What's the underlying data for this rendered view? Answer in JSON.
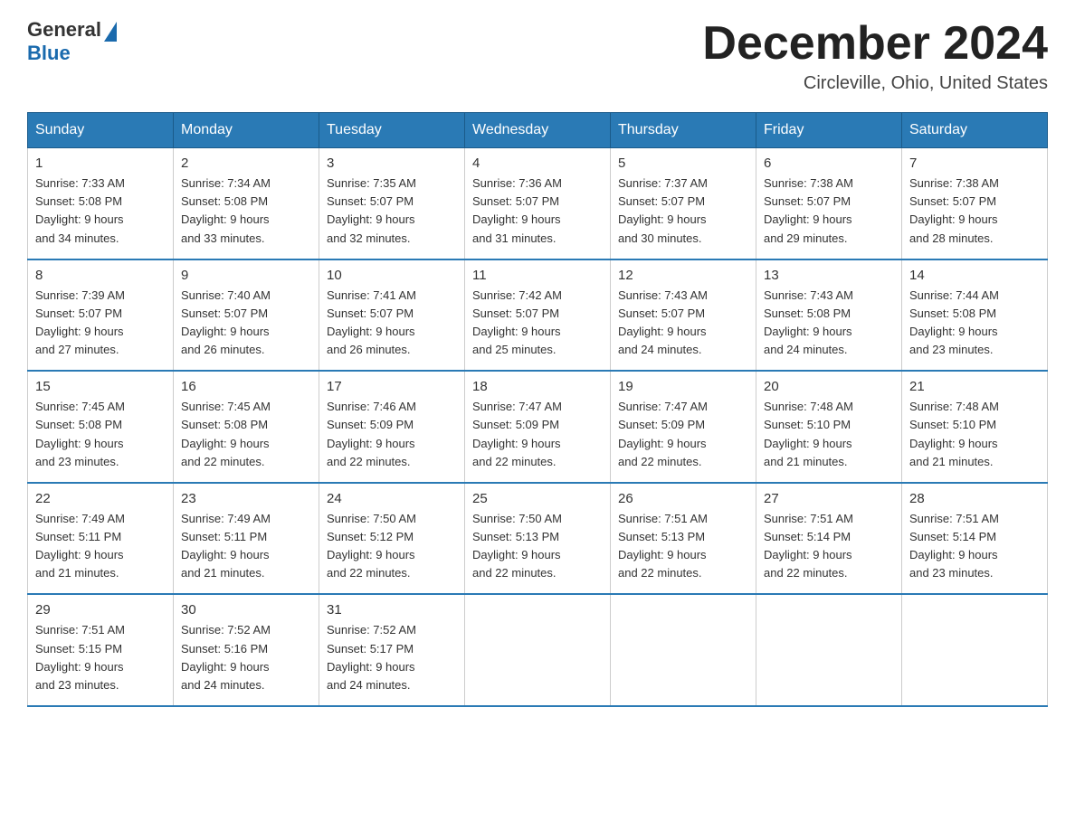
{
  "header": {
    "logo_general": "General",
    "logo_blue": "Blue",
    "month_title": "December 2024",
    "location": "Circleville, Ohio, United States"
  },
  "days_of_week": [
    "Sunday",
    "Monday",
    "Tuesday",
    "Wednesday",
    "Thursday",
    "Friday",
    "Saturday"
  ],
  "weeks": [
    [
      {
        "num": "1",
        "sunrise": "7:33 AM",
        "sunset": "5:08 PM",
        "daylight": "9 hours and 34 minutes."
      },
      {
        "num": "2",
        "sunrise": "7:34 AM",
        "sunset": "5:08 PM",
        "daylight": "9 hours and 33 minutes."
      },
      {
        "num": "3",
        "sunrise": "7:35 AM",
        "sunset": "5:07 PM",
        "daylight": "9 hours and 32 minutes."
      },
      {
        "num": "4",
        "sunrise": "7:36 AM",
        "sunset": "5:07 PM",
        "daylight": "9 hours and 31 minutes."
      },
      {
        "num": "5",
        "sunrise": "7:37 AM",
        "sunset": "5:07 PM",
        "daylight": "9 hours and 30 minutes."
      },
      {
        "num": "6",
        "sunrise": "7:38 AM",
        "sunset": "5:07 PM",
        "daylight": "9 hours and 29 minutes."
      },
      {
        "num": "7",
        "sunrise": "7:38 AM",
        "sunset": "5:07 PM",
        "daylight": "9 hours and 28 minutes."
      }
    ],
    [
      {
        "num": "8",
        "sunrise": "7:39 AM",
        "sunset": "5:07 PM",
        "daylight": "9 hours and 27 minutes."
      },
      {
        "num": "9",
        "sunrise": "7:40 AM",
        "sunset": "5:07 PM",
        "daylight": "9 hours and 26 minutes."
      },
      {
        "num": "10",
        "sunrise": "7:41 AM",
        "sunset": "5:07 PM",
        "daylight": "9 hours and 26 minutes."
      },
      {
        "num": "11",
        "sunrise": "7:42 AM",
        "sunset": "5:07 PM",
        "daylight": "9 hours and 25 minutes."
      },
      {
        "num": "12",
        "sunrise": "7:43 AM",
        "sunset": "5:07 PM",
        "daylight": "9 hours and 24 minutes."
      },
      {
        "num": "13",
        "sunrise": "7:43 AM",
        "sunset": "5:08 PM",
        "daylight": "9 hours and 24 minutes."
      },
      {
        "num": "14",
        "sunrise": "7:44 AM",
        "sunset": "5:08 PM",
        "daylight": "9 hours and 23 minutes."
      }
    ],
    [
      {
        "num": "15",
        "sunrise": "7:45 AM",
        "sunset": "5:08 PM",
        "daylight": "9 hours and 23 minutes."
      },
      {
        "num": "16",
        "sunrise": "7:45 AM",
        "sunset": "5:08 PM",
        "daylight": "9 hours and 22 minutes."
      },
      {
        "num": "17",
        "sunrise": "7:46 AM",
        "sunset": "5:09 PM",
        "daylight": "9 hours and 22 minutes."
      },
      {
        "num": "18",
        "sunrise": "7:47 AM",
        "sunset": "5:09 PM",
        "daylight": "9 hours and 22 minutes."
      },
      {
        "num": "19",
        "sunrise": "7:47 AM",
        "sunset": "5:09 PM",
        "daylight": "9 hours and 22 minutes."
      },
      {
        "num": "20",
        "sunrise": "7:48 AM",
        "sunset": "5:10 PM",
        "daylight": "9 hours and 21 minutes."
      },
      {
        "num": "21",
        "sunrise": "7:48 AM",
        "sunset": "5:10 PM",
        "daylight": "9 hours and 21 minutes."
      }
    ],
    [
      {
        "num": "22",
        "sunrise": "7:49 AM",
        "sunset": "5:11 PM",
        "daylight": "9 hours and 21 minutes."
      },
      {
        "num": "23",
        "sunrise": "7:49 AM",
        "sunset": "5:11 PM",
        "daylight": "9 hours and 21 minutes."
      },
      {
        "num": "24",
        "sunrise": "7:50 AM",
        "sunset": "5:12 PM",
        "daylight": "9 hours and 22 minutes."
      },
      {
        "num": "25",
        "sunrise": "7:50 AM",
        "sunset": "5:13 PM",
        "daylight": "9 hours and 22 minutes."
      },
      {
        "num": "26",
        "sunrise": "7:51 AM",
        "sunset": "5:13 PM",
        "daylight": "9 hours and 22 minutes."
      },
      {
        "num": "27",
        "sunrise": "7:51 AM",
        "sunset": "5:14 PM",
        "daylight": "9 hours and 22 minutes."
      },
      {
        "num": "28",
        "sunrise": "7:51 AM",
        "sunset": "5:14 PM",
        "daylight": "9 hours and 23 minutes."
      }
    ],
    [
      {
        "num": "29",
        "sunrise": "7:51 AM",
        "sunset": "5:15 PM",
        "daylight": "9 hours and 23 minutes."
      },
      {
        "num": "30",
        "sunrise": "7:52 AM",
        "sunset": "5:16 PM",
        "daylight": "9 hours and 24 minutes."
      },
      {
        "num": "31",
        "sunrise": "7:52 AM",
        "sunset": "5:17 PM",
        "daylight": "9 hours and 24 minutes."
      },
      null,
      null,
      null,
      null
    ]
  ]
}
